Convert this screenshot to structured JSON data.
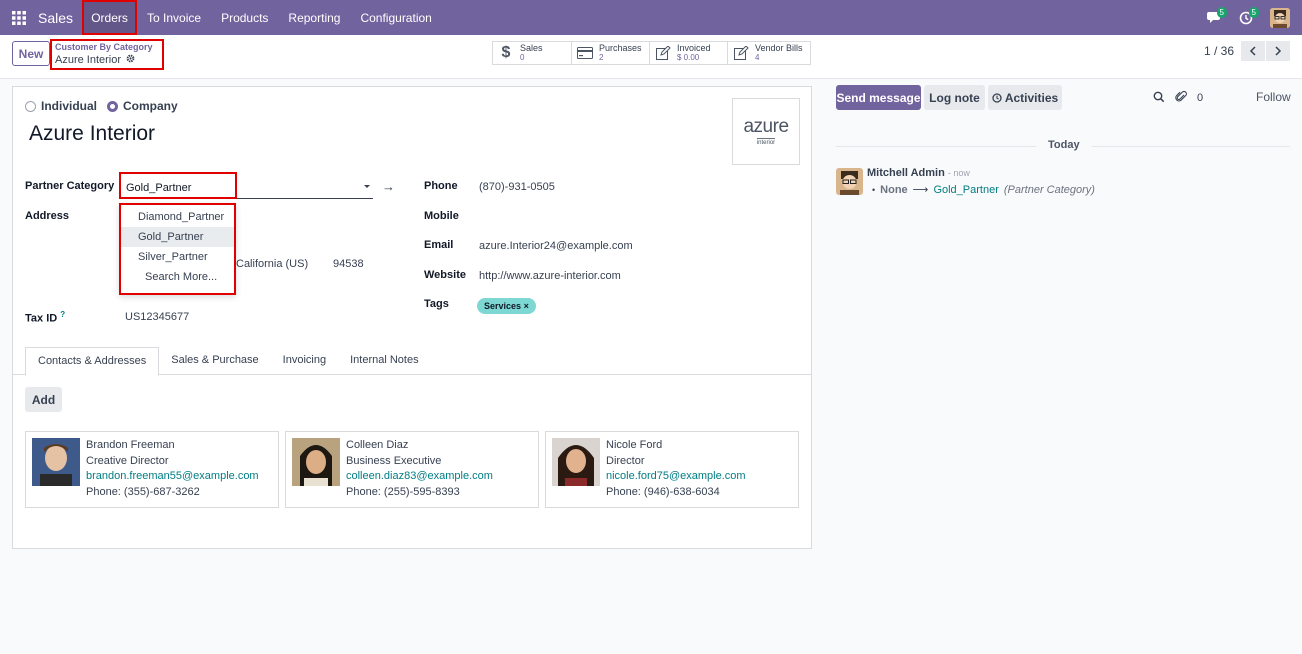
{
  "navbar": {
    "app_name": "Sales",
    "menus": [
      "Orders",
      "To Invoice",
      "Products",
      "Reporting",
      "Configuration"
    ],
    "messages_badge": "5",
    "activities_badge": "5"
  },
  "control": {
    "new_label": "New",
    "breadcrumb_parent": "Customer By Category",
    "breadcrumb_current": "Azure Interior",
    "smart_buttons": [
      {
        "label": "Sales",
        "value": "0"
      },
      {
        "label": "Purchases",
        "value": "2"
      },
      {
        "label": "Invoiced",
        "value": "$ 0.00"
      },
      {
        "label": "Vendor Bills",
        "value": "4"
      }
    ],
    "pager": "1 / 36"
  },
  "form": {
    "type_options": [
      "Individual",
      "Company"
    ],
    "selected_type": "Company",
    "name": "Azure Interior",
    "logo_text": "azure",
    "logo_subtext": "interior",
    "partner_category_label": "Partner Category",
    "partner_category_value": "Gold_Partner",
    "dropdown_options": [
      "Diamond_Partner",
      "Gold_Partner",
      "Silver_Partner"
    ],
    "dropdown_more": "Search More...",
    "address_label": "Address",
    "address_state": "California (US)",
    "address_zip": "94538",
    "tax_id_label": "Tax ID",
    "tax_id_help": "?",
    "tax_id_value": "US12345677",
    "phone_label": "Phone",
    "phone_value": "(870)-931-0505",
    "mobile_label": "Mobile",
    "email_label": "Email",
    "email_value": "azure.Interior24@example.com",
    "website_label": "Website",
    "website_value": "http://www.azure-interior.com",
    "tags_label": "Tags",
    "tag_value": "Services"
  },
  "tabs": [
    "Contacts & Addresses",
    "Sales & Purchase",
    "Invoicing",
    "Internal Notes"
  ],
  "add_label": "Add",
  "contacts": [
    {
      "name": "Brandon Freeman",
      "title": "Creative Director",
      "email": "brandon.freeman55@example.com",
      "phone": "Phone: (355)-687-3262"
    },
    {
      "name": "Colleen Diaz",
      "title": "Business Executive",
      "email": "colleen.diaz83@example.com",
      "phone": "Phone: (255)-595-8393"
    },
    {
      "name": "Nicole Ford",
      "title": "Director",
      "email": "nicole.ford75@example.com",
      "phone": "Phone: (946)-638-6034"
    }
  ],
  "chatter": {
    "send_message": "Send message",
    "log_note": "Log note",
    "activities": "Activities",
    "attachments_count": "0",
    "follow": "Follow",
    "today": "Today",
    "author": "Mitchell Admin",
    "time": "- now",
    "old_value": "None",
    "new_value": "Gold_Partner",
    "field_name": "(Partner Category)"
  },
  "colors": {
    "brand": "#71639e",
    "highlight": "#e00000",
    "link": "#017e84",
    "tag": "#7dd8d3"
  }
}
